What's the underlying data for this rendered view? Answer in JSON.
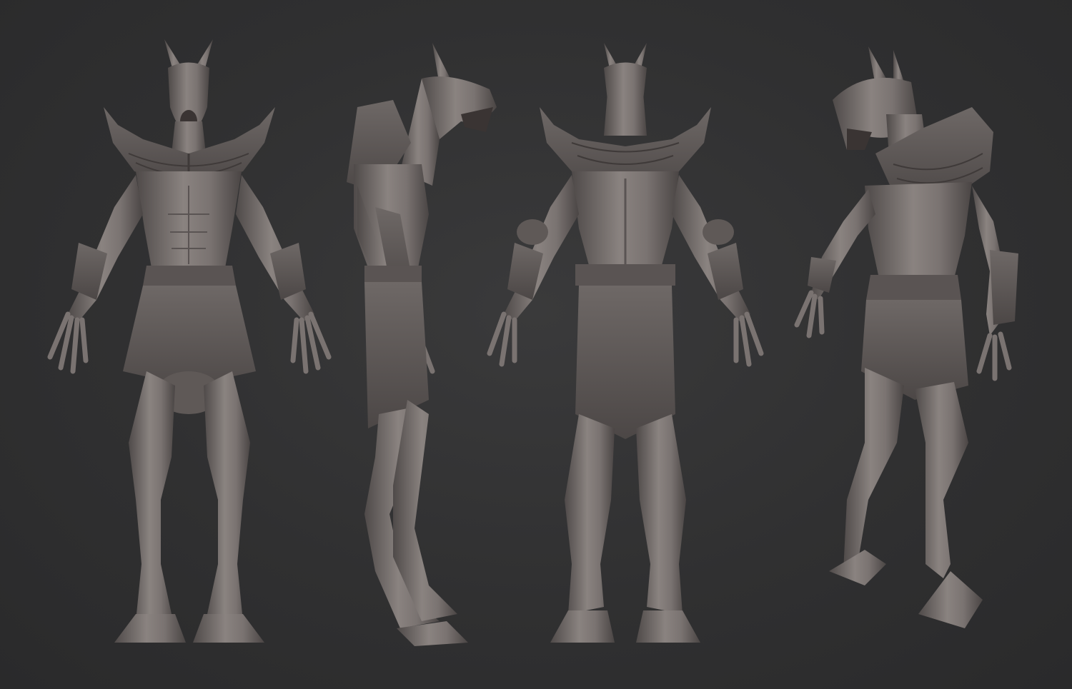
{
  "scene": {
    "background_color": "#313132",
    "clay_color": "#7a7371",
    "views": [
      {
        "name": "front",
        "icon": "anubis-front-figure"
      },
      {
        "name": "side",
        "icon": "anubis-side-figure"
      },
      {
        "name": "back",
        "icon": "anubis-back-figure"
      },
      {
        "name": "three-quarter",
        "icon": "anubis-three-quarter-figure"
      }
    ]
  }
}
